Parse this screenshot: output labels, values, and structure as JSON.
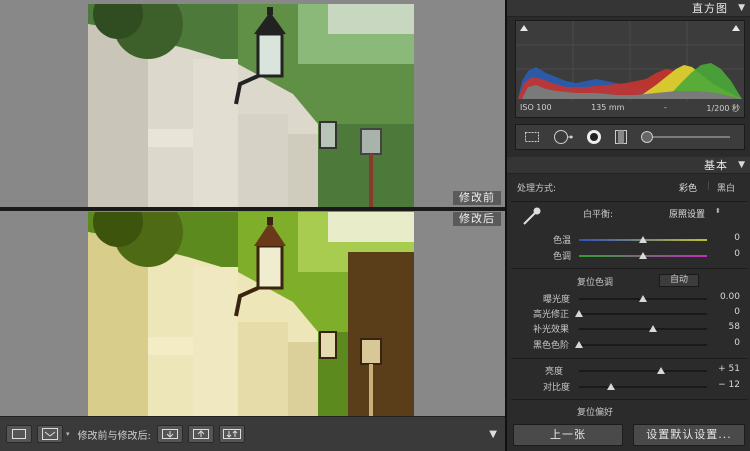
{
  "canvas": {
    "label_before": "修改前",
    "label_after": "修改后"
  },
  "toolbar": {
    "before_after_label": "修改前与修改后:"
  },
  "panel": {
    "histogram": {
      "title": "直方图",
      "iso": "ISO 100",
      "focal": "135 mm",
      "aperture": "-",
      "shutter": "1/200 秒"
    },
    "basic": {
      "title": "基本",
      "treatment_label": "处理方式:",
      "treatment_color": "彩色",
      "treatment_bw": "黑白",
      "wb_label": "白平衡:",
      "wb_value": "原照设置",
      "temp_label": "色温",
      "temp_value": "0",
      "tint_label": "色调",
      "tint_value": "0",
      "tone_label": "复位色调",
      "auto_label": "自动",
      "exposure_label": "曝光度",
      "exposure_value": "0.00",
      "recovery_label": "高光修正",
      "recovery_value": "0",
      "fill_label": "补光效果",
      "fill_value": "58",
      "blacks_label": "黑色色阶",
      "blacks_value": "0",
      "brightness_label": "亮度",
      "brightness_value": "+ 51",
      "contrast_label": "对比度",
      "contrast_value": "− 12",
      "presence_label": "复位偏好"
    },
    "prev_button": "上一张",
    "reset_button": "设置默认设置..."
  },
  "sliders": {
    "temp": 0.5,
    "tint": 0.5,
    "exposure": 0.5,
    "recovery": 0.0,
    "fill": 0.58,
    "blacks": 0.0,
    "brightness": 0.64,
    "contrast": 0.25
  },
  "colors": {
    "canvas_bg": "#888888",
    "panel_bg": "#2b2b2b",
    "accent": "#d8d8d8"
  }
}
